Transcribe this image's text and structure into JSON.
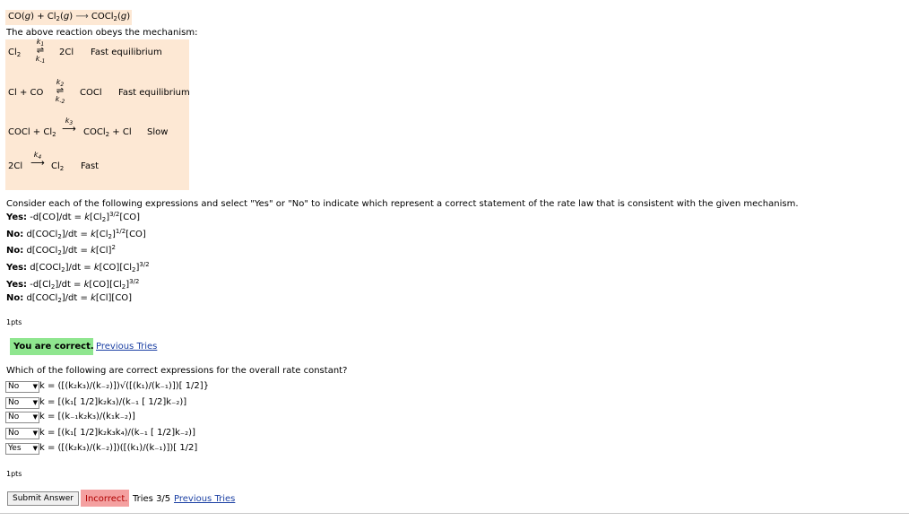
{
  "reaction": {
    "lhs1": "CO(",
    "lhs1_state": "g",
    "lhs1_close": ") + Cl",
    "lhs2_sub": "2",
    "lhs2_state_open": "(",
    "lhs2_state": "g",
    "lhs2_close": ")",
    "arrow": "⟶",
    "rhs": "COCl",
    "rhs_sub": "2",
    "rhs_state_open": "(",
    "rhs_state": "g",
    "rhs_close": ")"
  },
  "mechanism_intro": "The above reaction obeys the mechanism:",
  "mechanism": {
    "step1": {
      "reactant": "Cl",
      "reactant_sub": "2",
      "k_top": "k",
      "k_top_sub": "1",
      "k_bot": "k",
      "k_bot_sub": "-1",
      "product": "2Cl",
      "note": "Fast equilibrium"
    },
    "step2": {
      "reactant": "Cl + CO",
      "k_top": "k",
      "k_top_sub": "2",
      "k_bot": "k",
      "k_bot_sub": "-2",
      "product": "COCl",
      "note": "Fast equilibrium"
    },
    "step3": {
      "reactant": "COCl + Cl",
      "reactant_sub": "2",
      "k": "k",
      "k_sub": "3",
      "product": "COCl",
      "product_sub": "2",
      "product_tail": " + Cl",
      "note": "Slow"
    },
    "step4": {
      "reactant": "2Cl",
      "k": "k",
      "k_sub": "4",
      "product": "Cl",
      "product_sub": "2",
      "note": "Fast"
    }
  },
  "question1": "Consider each of the following expressions and select \"Yes\" or \"No\" to indicate which represent a correct statement of the rate law that is consistent with the given mechanism.",
  "answers1": [
    {
      "label": "Yes:",
      "text_a": "-d[CO]/dt = ",
      "k": "k",
      "text_b": "[Cl",
      "sub": "2",
      "text_c": "]",
      "sup": "3/2",
      "text_d": "[CO]"
    },
    {
      "label": "No:",
      "text_a": "d[COCl",
      "sub0": "2",
      "text_a2": "]/dt = ",
      "k": "k",
      "text_b": "[Cl",
      "sub": "2",
      "text_c": "]",
      "sup": "1/2",
      "text_d": "[CO]"
    },
    {
      "label": "No:",
      "text_a": "d[COCl",
      "sub0": "2",
      "text_a2": "]/dt = ",
      "k": "k",
      "text_b": "[Cl]",
      "sup": "2"
    },
    {
      "label": "Yes:",
      "text_a": "d[COCl",
      "sub0": "2",
      "text_a2": "]/dt = ",
      "k": "k",
      "text_b": "[CO][Cl",
      "sub": "2",
      "text_c": "]",
      "sup": "3/2"
    },
    {
      "label": "Yes:",
      "text_a": "-d[Cl",
      "sub0": "2",
      "text_a2": "]/dt = ",
      "k": "k",
      "text_b": "[CO][Cl",
      "sub": "2",
      "text_c": "]",
      "sup": "3/2"
    },
    {
      "label": "No:",
      "text_a": "d[COCl",
      "sub0": "2",
      "text_a2": "]/dt = ",
      "k": "k",
      "text_b": "[Cl][CO]"
    }
  ],
  "points1": "1pts",
  "feedback1": {
    "correct": "You are correct.",
    "previous": "Previous Tries"
  },
  "question2": "Which of the following are correct expressions for the overall rate constant?",
  "rate_constants": [
    {
      "selected": "No",
      "expr": "k = ([(k₂k₃)/(k₋₂)])√([(k₁)/(k₋₁)])[ 1/2]}"
    },
    {
      "selected": "No",
      "expr": "k = [(k₁[ 1/2]k₂k₃)/(k₋₁ [ 1/2]k₋₂)]"
    },
    {
      "selected": "No",
      "expr": "k = [(k₋₁k₂k₃)/(k₁k₋₂)]"
    },
    {
      "selected": "No",
      "expr": "k = [(k₁[ 1/2]k₂k₃k₄)/(k₋₁ [ 1/2]k₋₂)]"
    },
    {
      "selected": "Yes",
      "expr": "k = ([(k₂k₃)/(k₋₂)])([(k₁)/(k₋₁)])[ 1/2]"
    }
  ],
  "points2": "1pts",
  "submit": {
    "label": "Submit Answer",
    "status": "Incorrect.",
    "tries": "Tries 3/5",
    "previous": "Previous Tries"
  },
  "colors": {
    "highlight": "#fde8d4",
    "correct": "#8fe68f",
    "incorrect": "#f4a0a0",
    "link": "#1a3fa3"
  }
}
